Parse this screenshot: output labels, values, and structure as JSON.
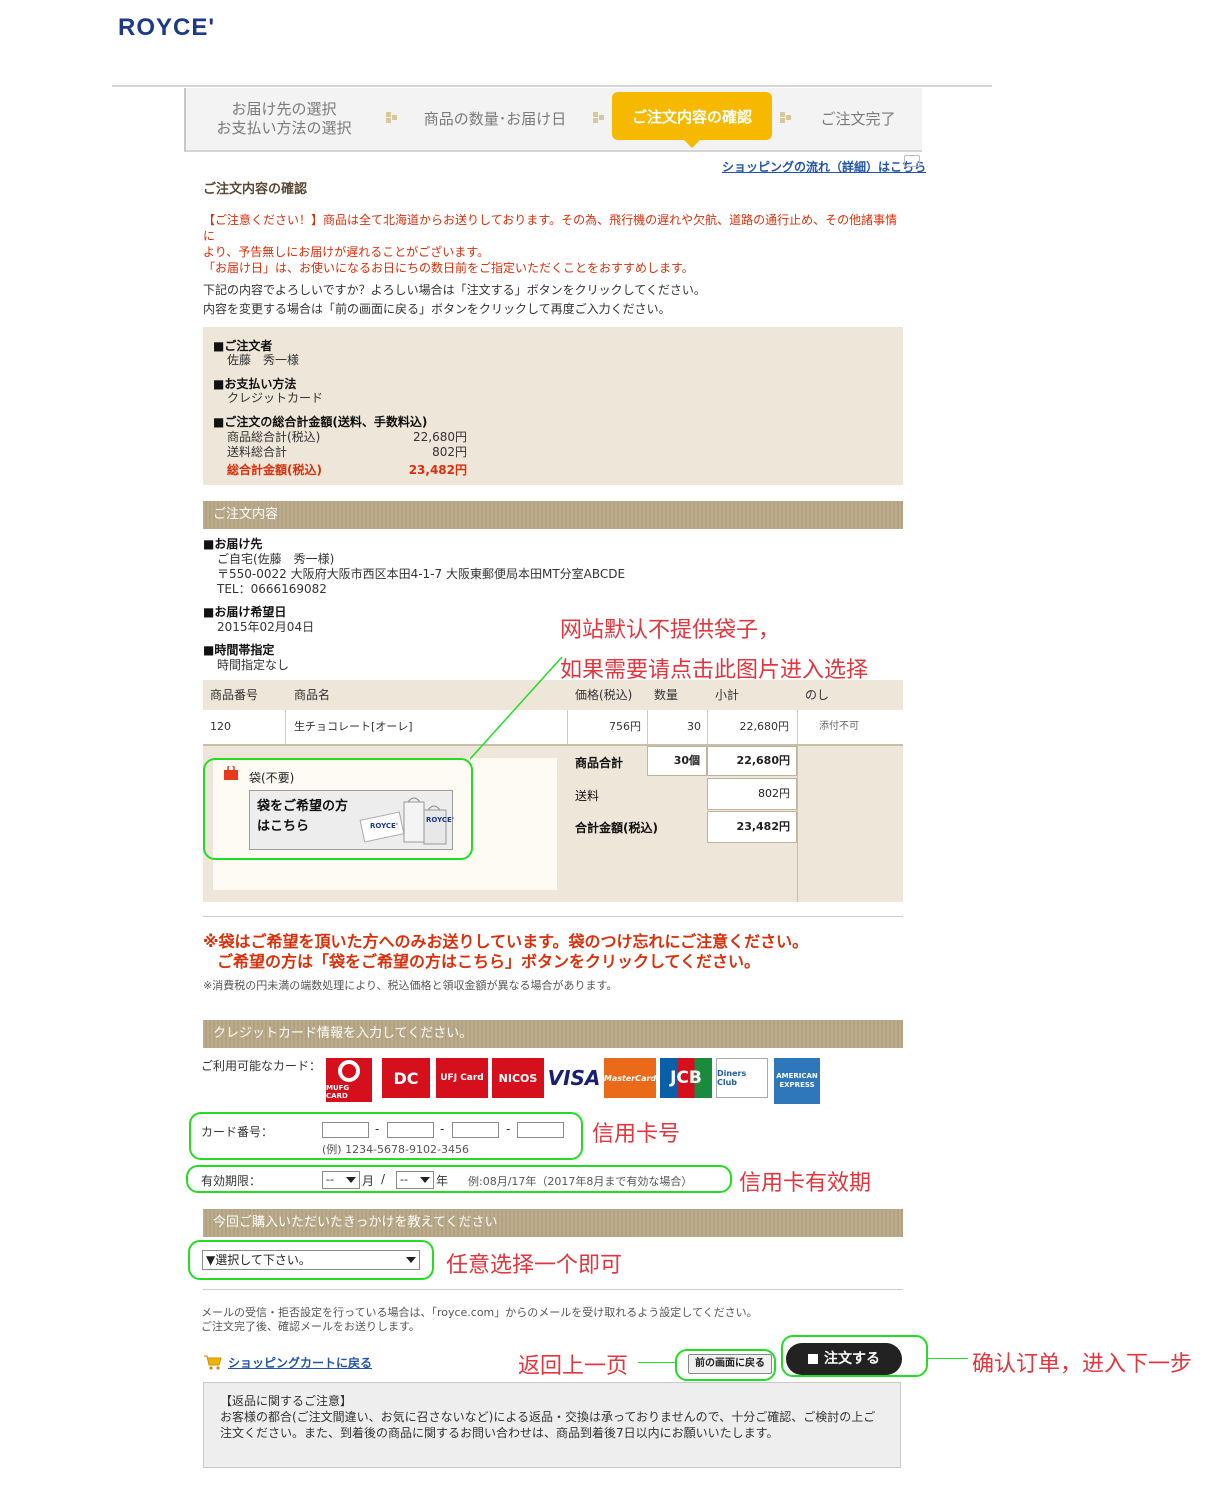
{
  "brand": {
    "logo": "ROYCE'"
  },
  "steps": {
    "step1_line1": "お届け先の選択",
    "step1_line2": "お支払い方法の選択",
    "step2": "商品の数量･お届け日",
    "step3": "ご注文内容の確認",
    "step4": "ご注文完了"
  },
  "flow_link": "ショッピングの流れ（詳細）はこちら",
  "page_title": "ご注文内容の確認",
  "warning": {
    "line1": "【ご注意ください！】商品は全て北海道からお送りしております。その為、飛行機の遅れや欠航、道路の通行止め、その他諸事情に",
    "line2": "より、予告無しにお届けが遅れることがございます。",
    "line3": "「お届け日」は、お使いになるお日にちの数日前をご指定いただくことをおすすめします。"
  },
  "intro": {
    "line1": "下記の内容でよろしいですか？よろしい場合は「注文する」ボタンをクリックしてください。",
    "line2": "内容を変更する場合は「前の画面に戻る」ボタンをクリックして再度ご入力ください。"
  },
  "summary": {
    "orderer_label": "■ご注文者",
    "orderer_name": "佐藤　秀一様",
    "payment_label": "■お支払い方法",
    "payment_value": "クレジットカード",
    "total_label": "■ご注文の総合計金額(送料、手数料込)",
    "subtotal_label": "商品総合計(税込)",
    "subtotal_value": "22,680円",
    "shipping_label": "送料総合計",
    "shipping_value": "802円",
    "grand_label": "総合計金額(税込)",
    "grand_value": "23,482円"
  },
  "order_section_title": "ご注文内容",
  "shipping": {
    "dest_label": "■お届け先",
    "dest_name": "ご自宅(佐藤　秀一様)",
    "dest_address": "〒550-0022 大阪府大阪市西区本田4-1-7 大阪東郵便局本田MT分室ABCDE",
    "dest_tel": "TEL：0666169082",
    "date_label": "■お届け希望日",
    "date_value": "2015年02月04日",
    "time_label": "■時間帯指定",
    "time_value": "時間指定なし"
  },
  "table": {
    "headers": [
      "商品番号",
      "商品名",
      "価格(税込)",
      "数量",
      "小計",
      "のし"
    ],
    "row": {
      "no": "120",
      "name": "生チョコレート[オーレ]",
      "price": "756円",
      "qty": "30",
      "subtotal": "22,680円",
      "noshi": "添付不可"
    },
    "bag_label": "袋(不要)",
    "bag_button_line1": "袋をご希望の方",
    "bag_button_line2": "はこちら",
    "bag_image_text": "ROYCE'",
    "total_goods_label": "商品合計",
    "total_goods_qty": "30個",
    "total_goods_value": "22,680円",
    "postage_label": "送料",
    "postage_value": "802円",
    "grand_label": "合計金額(税込)",
    "grand_value": "23,482円"
  },
  "bag_note": {
    "line1": "※袋はご希望を頂いた方へのみお送りしています。袋のつけ忘れにご注意ください。",
    "line2": "ご希望の方は「袋をご希望の方はこちら」ボタンをクリックしてください。",
    "tax_note": "※消費税の円未満の端数処理により、税込価格と領収金額が異なる場合があります。"
  },
  "credit": {
    "title": "クレジットカード情報を入力してください。",
    "available_label": "ご利用可能なカード：",
    "cards": [
      {
        "name": "MUFG CARD",
        "color": "#d60f1c"
      },
      {
        "name": "DC",
        "color": "#d60f1c"
      },
      {
        "name": "UFJ Card",
        "color": "#d60f1c"
      },
      {
        "name": "NICOS",
        "color": "#d60f1c"
      },
      {
        "name": "VISA",
        "color": "#1a1f71"
      },
      {
        "name": "MasterCard",
        "color": "#eb6a1a"
      },
      {
        "name": "JCB",
        "color": "#0b5fa8"
      },
      {
        "name": "Diners Club",
        "color": "#1f5fa3"
      },
      {
        "name": "AMERICAN EXPRESS",
        "color": "#2e77bb"
      }
    ],
    "card_no_label": "カード番号：",
    "card_no_example": "(例) 1234-5678-9102-3456",
    "dash": "-",
    "expiry_label": "有効期限：",
    "month_value": "--",
    "month_unit": "月",
    "slash": "/",
    "year_value": "--",
    "year_unit": "年",
    "expiry_example": "例:08月/17年（2017年8月まで有効な場合）"
  },
  "survey": {
    "title": "今回ご購入いただいたきっかけを教えてください",
    "select_value": "▼選択して下さい。"
  },
  "mail_note": {
    "line1": "メールの受信・拒否設定を行っている場合は、「royce.com」からのメールを受け取れるよう設定してください。",
    "line2": "ご注文完了後、確認メールをお送りします。"
  },
  "buttons": {
    "cart_link": "ショッピングカートに戻る",
    "back": "前の画面に戻る",
    "order": "注文する"
  },
  "returns": {
    "title": "【返品に関するご注意】",
    "line1": "お客様の都合(ご注文間違い、お気に召さないなど)による返品・交換は承っておりませんので、十分ご確認、ご検討の上ご",
    "line2": "注文ください。また、到着後の商品に関するお問い合わせは、商品到着後7日以内にお願いいたします。"
  },
  "annotations": {
    "bag_1": "网站默认不提供袋子，",
    "bag_2": "如果需要请点击此图片进入选择",
    "card_no": "信用卡号",
    "expiry": "信用卡有效期",
    "survey": "任意选择一个即可",
    "back": "返回上一页",
    "order": "确认订单，进入下一步"
  },
  "colors": {
    "accent": "#f7b800",
    "warning": "#d9300b",
    "annotation": "#e0363d",
    "highlight": "#22dd22",
    "section_bar": "#b8a886"
  }
}
